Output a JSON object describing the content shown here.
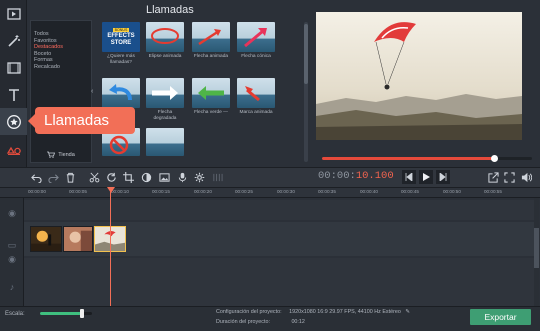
{
  "panel": {
    "title": "Llamadas",
    "collapse_glyph": "‹"
  },
  "categories": [
    {
      "label": "Todos",
      "selected": false
    },
    {
      "label": "Favoritos",
      "selected": false
    },
    {
      "label": "Destacados",
      "selected": true
    },
    {
      "label": "Boceto",
      "selected": false
    },
    {
      "label": "Formas",
      "selected": false
    },
    {
      "label": "Recalcado",
      "selected": false
    }
  ],
  "store_button": {
    "label": "Tienda",
    "icon": "cart-icon"
  },
  "stickers": [
    {
      "caption": "¿Quiere más llamadas?",
      "kind": "store",
      "badge": "BONUS",
      "line1": "EFFECTS",
      "line2": "STORE"
    },
    {
      "caption": "Elipse animada",
      "kind": "ellipse"
    },
    {
      "caption": "Flecha animada",
      "kind": "arrow-red"
    },
    {
      "caption": "Flecha cónica",
      "kind": "arrow-pink"
    },
    {
      "caption": "",
      "kind": "arrow-blue"
    },
    {
      "caption": "Flecha degradada",
      "kind": "arrow-white"
    },
    {
      "caption": "Flecha verde —",
      "kind": "arrow-green"
    },
    {
      "caption": "Marca animada",
      "kind": "mark-red"
    },
    {
      "caption": "",
      "kind": "forbidden"
    },
    {
      "caption": "",
      "kind": "sea"
    }
  ],
  "tooltip": {
    "label": "Llamadas"
  },
  "rail": [
    {
      "icon": "media-import-icon"
    },
    {
      "icon": "magic-wand-icon"
    },
    {
      "icon": "film-strip-icon"
    },
    {
      "icon": "text-icon"
    },
    {
      "icon": "callout-star-icon",
      "active": true
    },
    {
      "icon": "shapes-icon"
    },
    {
      "icon": "menu-icon"
    }
  ],
  "player": {
    "timecode_prefix": "00:00:",
    "timecode_hot": "10.100",
    "progress": 0.82
  },
  "ruler_ticks": [
    "00:00:00",
    "00:00:05",
    "00:00:10",
    "00:00:15",
    "00:00:20",
    "00:00:25",
    "00:00:30",
    "00:00:35",
    "00:00:40",
    "00:00:45",
    "00:00:50",
    "00:00:55"
  ],
  "footer": {
    "scale_label": "Escala:",
    "scale_value": 0.8,
    "config_label": "Configuración del proyecto:",
    "config_value": "1920x1080 16:9 29.97 FPS, 44100 Hz Estéreo",
    "duration_label": "Duración del proyecto:",
    "duration_value": "00:12",
    "export_label": "Exportar"
  },
  "colors": {
    "accent": "#f26f57",
    "export": "#3e9e73",
    "scale": "#3fbf7f"
  }
}
